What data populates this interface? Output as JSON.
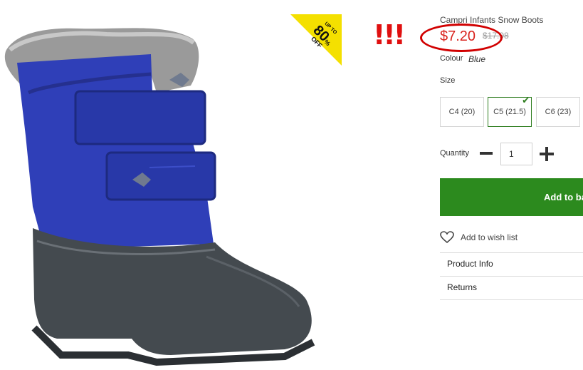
{
  "product": {
    "title": "Campri Infants Snow Boots",
    "price": "$7.20",
    "old_price": "$17.98",
    "colour_label": "Colour",
    "colour_value": "Blue"
  },
  "promo": {
    "up_to": "UP TO",
    "percent": "80",
    "unit": "%",
    "off": "OFF",
    "annotation": "!!!"
  },
  "size": {
    "label": "Size",
    "options": [
      "C4 (20)",
      "C5 (21.5)",
      "C6 (23)"
    ],
    "selected": "C5 (21.5)"
  },
  "quantity": {
    "label": "Quantity",
    "value": "1"
  },
  "actions": {
    "add_to_bag": "Add to bag",
    "wishlist": "Add to wish list"
  },
  "accordion": [
    "Product Info",
    "Returns"
  ],
  "colors": {
    "accent_green": "#2c8a1e",
    "price_red": "#d9231d",
    "boot_blue": "#2f3fb8",
    "promo_yellow": "#f4e000"
  },
  "icons": [
    "check-icon",
    "minus-icon",
    "plus-icon",
    "heart-icon"
  ]
}
